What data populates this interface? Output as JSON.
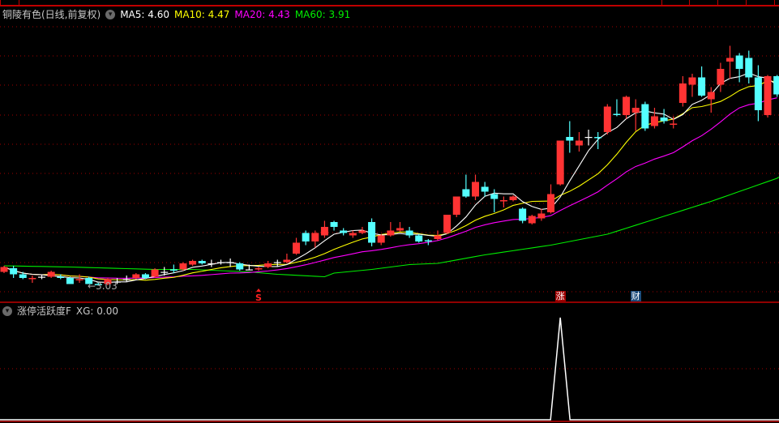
{
  "header": {
    "title": "铜陵有色(日线,前复权)",
    "ma5": "MA5: 4.60",
    "ma10": "MA10: 4.47",
    "ma20": "MA20: 4.43",
    "ma60": "MA60: 3.91"
  },
  "colors": {
    "up": "#ff3333",
    "down": "#54ffff",
    "doji": "#ffffff",
    "ma5": "#ffffff",
    "ma10": "#ffff00",
    "ma20": "#ff00ff",
    "ma60": "#00ee00",
    "grid": "#a00000"
  },
  "low_label": "←3.03",
  "markers": [
    {
      "text": "S",
      "index": 27,
      "style": "s"
    },
    {
      "text": "涨",
      "index": 59,
      "style": "zhang"
    },
    {
      "text": "财",
      "index": 67,
      "style": "cai"
    }
  ],
  "indicator": {
    "title": "涨停活跃度F",
    "value": "XG: 0.00",
    "signal_indices": [
      59
    ]
  },
  "chart_data": {
    "type": "candlestick",
    "price_range": [
      3.03,
      5.0
    ],
    "ohlc": [
      [
        3.14,
        3.19,
        3.13,
        3.18
      ],
      [
        3.17,
        3.19,
        3.09,
        3.12
      ],
      [
        3.12,
        3.14,
        3.08,
        3.09
      ],
      [
        3.08,
        3.11,
        3.05,
        3.09
      ],
      [
        3.1,
        3.12,
        3.08,
        3.1
      ],
      [
        3.1,
        3.15,
        3.09,
        3.14
      ],
      [
        3.1,
        3.12,
        3.08,
        3.09
      ],
      [
        3.09,
        3.1,
        3.04,
        3.04
      ],
      [
        3.07,
        3.12,
        3.05,
        3.08
      ],
      [
        3.09,
        3.1,
        3.04,
        3.04
      ],
      [
        3.04,
        3.05,
        3.03,
        3.03
      ],
      [
        3.04,
        3.09,
        3.03,
        3.08
      ],
      [
        3.06,
        3.09,
        3.04,
        3.06
      ],
      [
        3.08,
        3.11,
        3.06,
        3.08
      ],
      [
        3.09,
        3.13,
        3.08,
        3.12
      ],
      [
        3.12,
        3.13,
        3.08,
        3.09
      ],
      [
        3.1,
        3.17,
        3.09,
        3.16
      ],
      [
        3.14,
        3.18,
        3.11,
        3.14
      ],
      [
        3.16,
        3.2,
        3.13,
        3.15
      ],
      [
        3.16,
        3.22,
        3.15,
        3.21
      ],
      [
        3.2,
        3.24,
        3.19,
        3.23
      ],
      [
        3.23,
        3.24,
        3.2,
        3.21
      ],
      [
        3.21,
        3.24,
        3.18,
        3.21
      ],
      [
        3.22,
        3.24,
        3.2,
        3.22
      ],
      [
        3.22,
        3.25,
        3.18,
        3.22
      ],
      [
        3.21,
        3.22,
        3.15,
        3.16
      ],
      [
        3.16,
        3.2,
        3.16,
        3.16
      ],
      [
        3.16,
        3.18,
        3.15,
        3.17
      ],
      [
        3.18,
        3.23,
        3.17,
        3.21
      ],
      [
        3.22,
        3.24,
        3.18,
        3.22
      ],
      [
        3.22,
        3.29,
        3.21,
        3.24
      ],
      [
        3.29,
        3.42,
        3.28,
        3.38
      ],
      [
        3.46,
        3.48,
        3.36,
        3.39
      ],
      [
        3.39,
        3.48,
        3.34,
        3.46
      ],
      [
        3.44,
        3.56,
        3.42,
        3.51
      ],
      [
        3.55,
        3.56,
        3.48,
        3.51
      ],
      [
        3.48,
        3.5,
        3.44,
        3.46
      ],
      [
        3.44,
        3.48,
        3.42,
        3.46
      ],
      [
        3.46,
        3.51,
        3.45,
        3.48
      ],
      [
        3.55,
        3.58,
        3.35,
        3.38
      ],
      [
        3.38,
        3.45,
        3.36,
        3.44
      ],
      [
        3.44,
        3.55,
        3.43,
        3.48
      ],
      [
        3.48,
        3.55,
        3.47,
        3.5
      ],
      [
        3.48,
        3.51,
        3.42,
        3.44
      ],
      [
        3.44,
        3.45,
        3.38,
        3.39
      ],
      [
        3.4,
        3.41,
        3.36,
        3.39
      ],
      [
        3.41,
        3.48,
        3.4,
        3.44
      ],
      [
        3.46,
        3.61,
        3.45,
        3.61
      ],
      [
        3.61,
        3.76,
        3.59,
        3.76
      ],
      [
        3.82,
        3.94,
        3.75,
        3.76
      ],
      [
        3.76,
        3.94,
        3.73,
        3.88
      ],
      [
        3.84,
        3.88,
        3.76,
        3.8
      ],
      [
        3.78,
        3.82,
        3.63,
        3.74
      ],
      [
        3.72,
        3.76,
        3.67,
        3.73
      ],
      [
        3.73,
        3.77,
        3.72,
        3.76
      ],
      [
        3.66,
        3.67,
        3.54,
        3.56
      ],
      [
        3.54,
        3.61,
        3.53,
        3.6
      ],
      [
        3.58,
        3.66,
        3.56,
        3.62
      ],
      [
        3.63,
        3.86,
        3.62,
        3.78
      ],
      [
        3.86,
        4.22,
        3.85,
        4.22
      ],
      [
        4.25,
        4.38,
        4.12,
        4.22
      ],
      [
        4.18,
        4.29,
        4.13,
        4.22
      ],
      [
        4.25,
        4.31,
        4.18,
        4.25
      ],
      [
        4.25,
        4.29,
        4.15,
        4.24
      ],
      [
        4.29,
        4.52,
        4.27,
        4.5
      ],
      [
        4.44,
        4.56,
        4.42,
        4.43
      ],
      [
        4.43,
        4.59,
        4.4,
        4.58
      ],
      [
        4.45,
        4.56,
        4.3,
        4.49
      ],
      [
        4.52,
        4.54,
        4.3,
        4.32
      ],
      [
        4.34,
        4.49,
        4.32,
        4.42
      ],
      [
        4.41,
        4.48,
        4.36,
        4.38
      ],
      [
        4.35,
        4.42,
        4.32,
        4.36
      ],
      [
        4.53,
        4.75,
        4.5,
        4.69
      ],
      [
        4.68,
        4.77,
        4.58,
        4.74
      ],
      [
        4.74,
        4.83,
        4.58,
        4.59
      ],
      [
        4.56,
        4.66,
        4.45,
        4.62
      ],
      [
        4.68,
        4.86,
        4.62,
        4.81
      ],
      [
        4.87,
        5.0,
        4.73,
        4.9
      ],
      [
        4.92,
        4.94,
        4.7,
        4.81
      ],
      [
        4.9,
        4.96,
        4.69,
        4.74
      ],
      [
        4.74,
        4.84,
        4.38,
        4.47
      ],
      [
        4.43,
        4.76,
        4.41,
        4.75
      ],
      [
        4.75,
        4.76,
        4.58,
        4.6
      ]
    ],
    "ma60_points": [
      [
        0,
        3.19
      ],
      [
        7,
        3.18
      ],
      [
        16,
        3.16
      ],
      [
        20,
        3.16
      ],
      [
        26,
        3.14
      ],
      [
        29,
        3.12
      ],
      [
        34,
        3.1
      ],
      [
        35,
        3.13
      ],
      [
        39,
        3.16
      ],
      [
        43,
        3.2
      ],
      [
        46,
        3.21
      ],
      [
        51,
        3.28
      ],
      [
        58,
        3.36
      ],
      [
        64,
        3.45
      ],
      [
        75,
        3.72
      ],
      [
        82,
        3.91
      ]
    ]
  }
}
